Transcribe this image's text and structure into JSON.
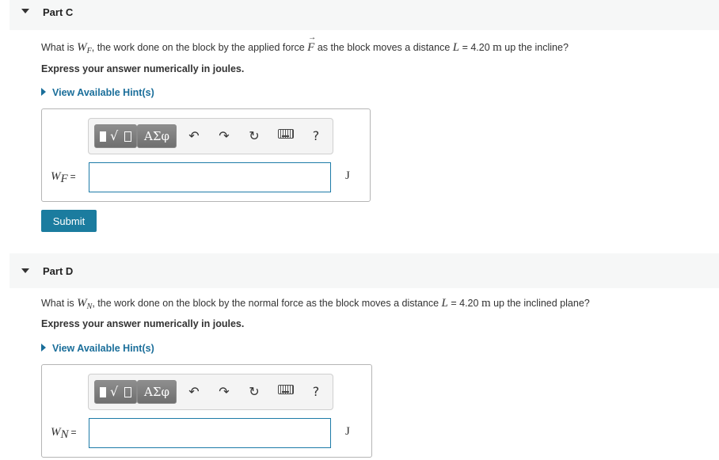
{
  "partC": {
    "title": "Part C",
    "q_prefix": "What is ",
    "q_var": "W",
    "q_var_sub": "F",
    "q_mid": ", the work done on the block by the applied force ",
    "q_force": "F",
    "q_mid2": " as the block moves a distance ",
    "q_L": "L",
    "q_value": " = 4.20 ",
    "q_unit": "m",
    "q_suffix": " up the incline?",
    "instruction": "Express your answer numerically in joules.",
    "hint": "View Available Hint(s)",
    "input_label_var": "W",
    "input_label_sub": "F",
    "input_label_eq": "=",
    "input_value": "",
    "unit": "J",
    "submit": "Submit"
  },
  "partD": {
    "title": "Part D",
    "q_prefix": "What is ",
    "q_var": "W",
    "q_var_sub": "N",
    "q_mid": ", the work done on the block by the normal force as the block moves a distance ",
    "q_L": "L",
    "q_value": " = 4.20 ",
    "q_unit": "m",
    "q_suffix": " up the inclined plane?",
    "instruction": "Express your answer numerically in joules.",
    "hint": "View Available Hint(s)",
    "input_label_var": "W",
    "input_label_sub": "N",
    "input_label_eq": "=",
    "input_value": "",
    "unit": "J"
  },
  "toolbar": {
    "greek_label": "ΑΣφ",
    "undo_glyph": "↶",
    "redo_glyph": "↷",
    "reset_glyph": "↻",
    "help_glyph": "?",
    "icons": [
      "templates-icon",
      "greek-icon",
      "undo-icon",
      "redo-icon",
      "reset-icon",
      "keyboard-icon",
      "help-icon"
    ]
  },
  "colors": {
    "accent": "#1b7c9f",
    "link": "#1a6e9a",
    "header_bg": "#f6f7f7"
  }
}
